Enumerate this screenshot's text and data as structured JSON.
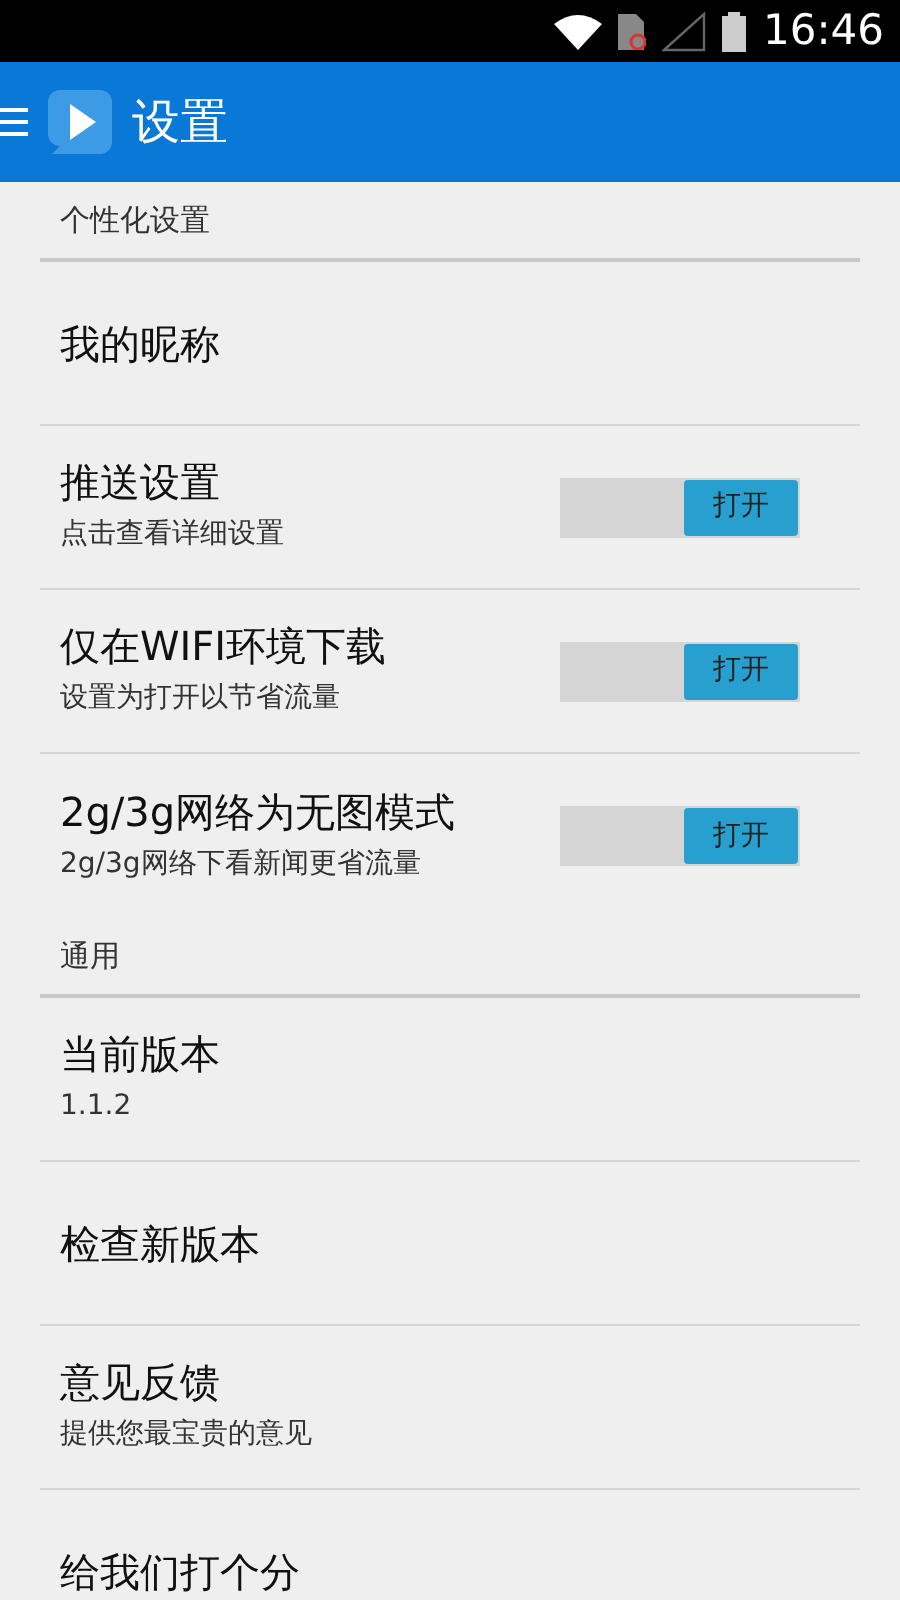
{
  "status_bar": {
    "time": "16:46"
  },
  "app_bar": {
    "title": "设置"
  },
  "sections": [
    {
      "header": "个性化设置",
      "items": [
        {
          "kind": "plain",
          "title": "我的昵称"
        },
        {
          "kind": "toggle",
          "title": "推送设置",
          "subtitle": "点击查看详细设置",
          "on": true,
          "toggle_label": "打开"
        },
        {
          "kind": "toggle",
          "title": "仅在WIFI环境下载",
          "subtitle": "设置为打开以节省流量",
          "on": true,
          "toggle_label": "打开"
        },
        {
          "kind": "toggle",
          "title": "2g/3g网络为无图模式",
          "subtitle": "2g/3g网络下看新闻更省流量",
          "on": true,
          "toggle_label": "打开"
        }
      ]
    },
    {
      "header": "通用",
      "items": [
        {
          "kind": "plain",
          "title": "当前版本",
          "subtitle": "1.1.2"
        },
        {
          "kind": "plain",
          "title": "检查新版本"
        },
        {
          "kind": "plain",
          "title": "意见反馈",
          "subtitle": "提供您最宝贵的意见"
        },
        {
          "kind": "plain",
          "title": "给我们打个分"
        }
      ]
    }
  ]
}
